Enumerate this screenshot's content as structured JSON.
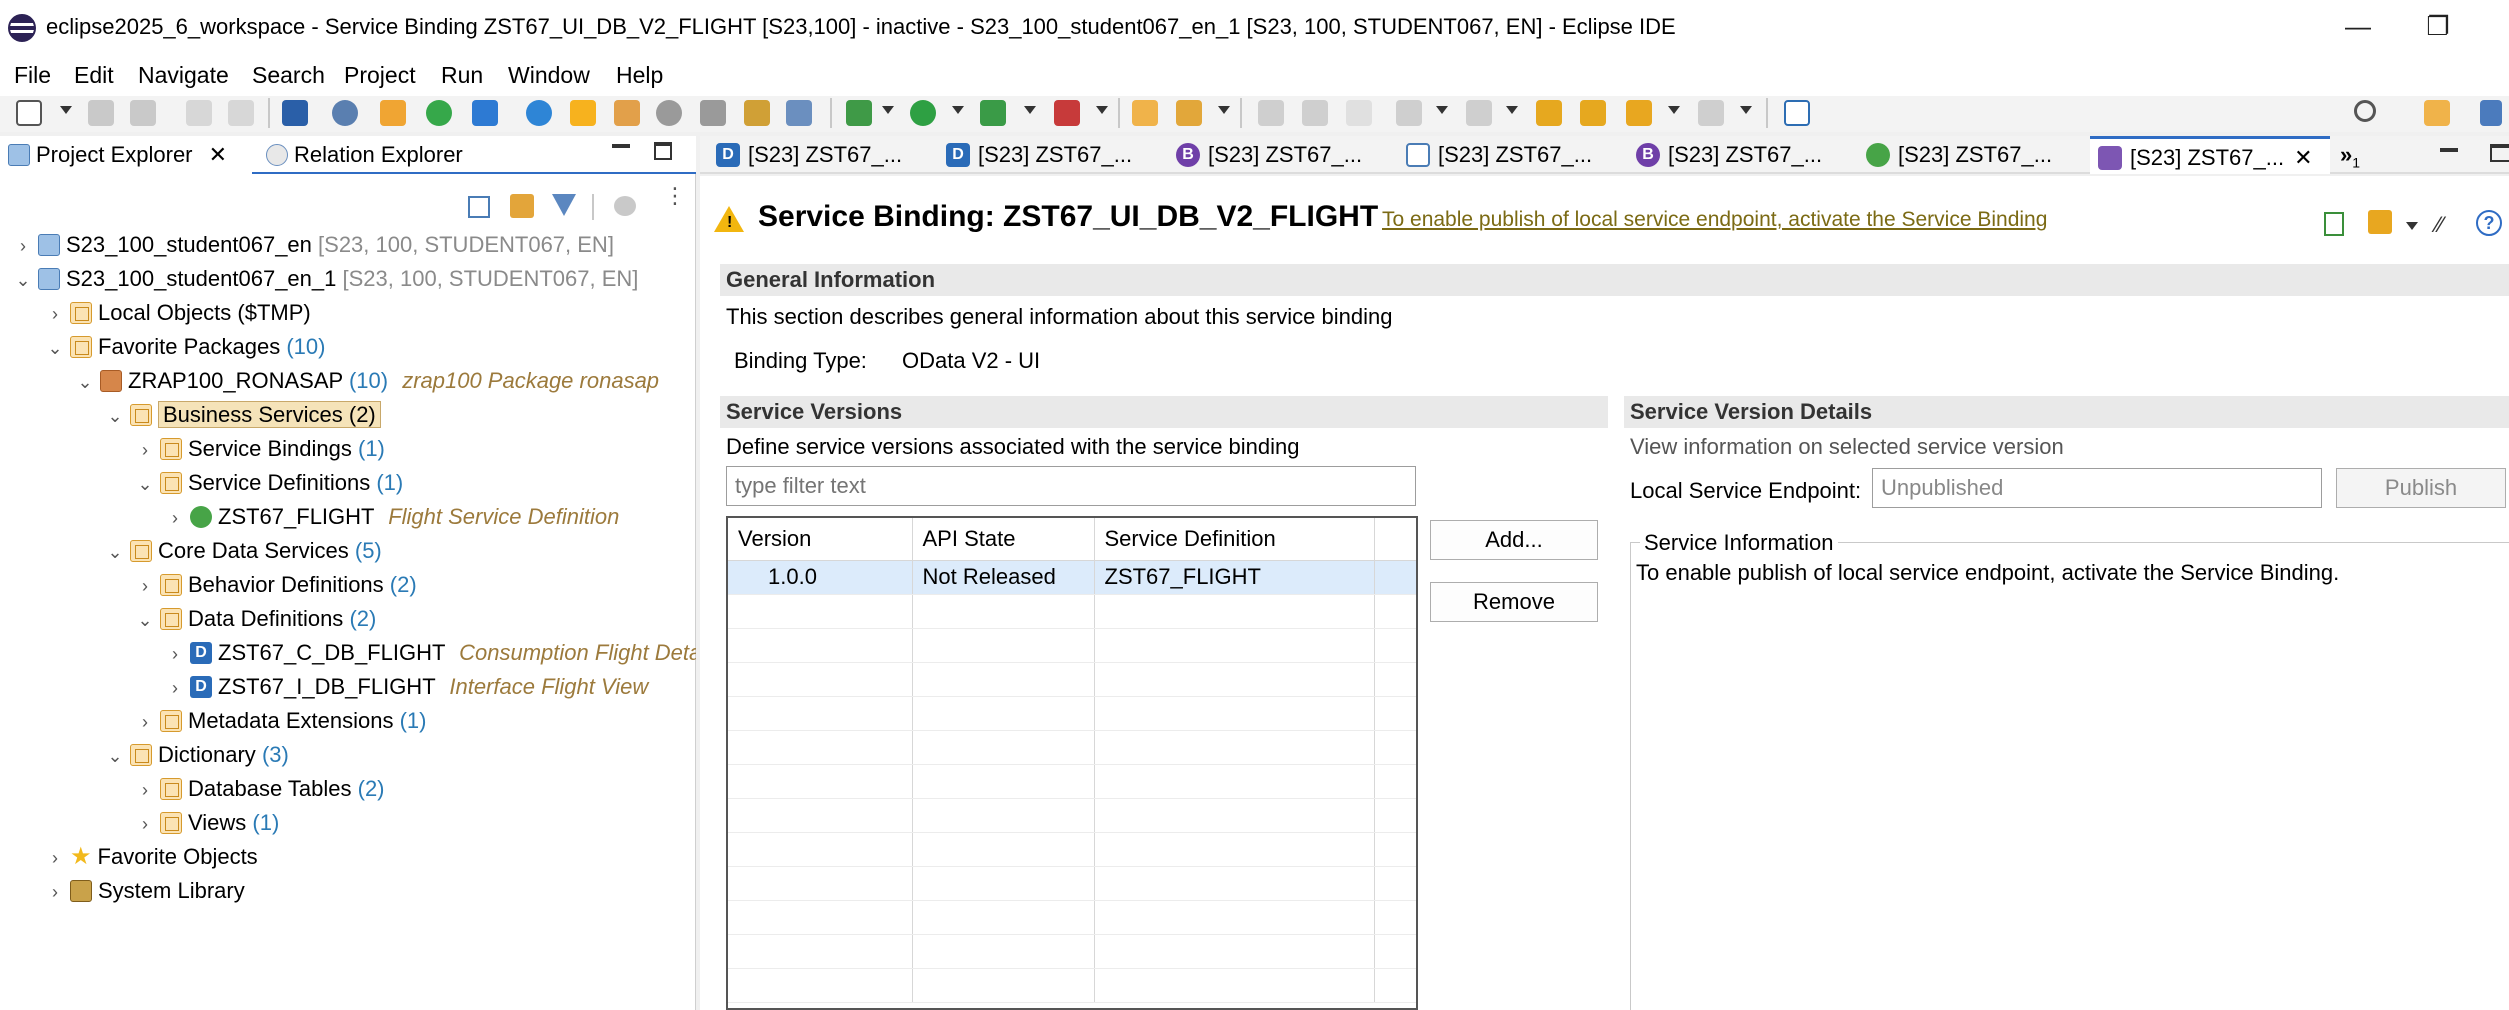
{
  "window": {
    "title": "eclipse2025_6_workspace - Service Binding ZST67_UI_DB_V2_FLIGHT [S23,100] - inactive - S23_100_student067_en_1 [S23, 100, STUDENT067, EN] - Eclipse IDE",
    "minimize": "—",
    "restore": "❐"
  },
  "menu": [
    "File",
    "Edit",
    "Navigate",
    "Search",
    "Project",
    "Run",
    "Window",
    "Help"
  ],
  "left_tabs": {
    "project_explorer": "Project Explorer",
    "relation_explorer": "Relation Explorer",
    "close": "✕"
  },
  "tree": [
    {
      "label": "S23_100_student067_en",
      "hint": "[S23, 100, STUDENT067, EN]"
    },
    {
      "label": "S23_100_student067_en_1",
      "hint": "[S23, 100, STUDENT067, EN]"
    },
    {
      "label": "Local Objects ($TMP)"
    },
    {
      "label": "Favorite Packages",
      "count": "(10)"
    },
    {
      "label": "ZRAP100_RONASAP",
      "count": "(10)",
      "desc": "zrap100 Package ronasap"
    },
    {
      "label": "Business Services",
      "count": "(2)"
    },
    {
      "label": "Service Bindings",
      "count": "(1)"
    },
    {
      "label": "Service Definitions",
      "count": "(1)"
    },
    {
      "label": "ZST67_FLIGHT",
      "desc": "Flight Service Definition"
    },
    {
      "label": "Core Data Services",
      "count": "(5)"
    },
    {
      "label": "Behavior Definitions",
      "count": "(2)"
    },
    {
      "label": "Data Definitions",
      "count": "(2)"
    },
    {
      "label": "ZST67_C_DB_FLIGHT",
      "desc": "Consumption Flight Deta"
    },
    {
      "label": "ZST67_I_DB_FLIGHT",
      "desc": "Interface Flight View"
    },
    {
      "label": "Metadata Extensions",
      "count": "(1)"
    },
    {
      "label": "Dictionary",
      "count": "(3)"
    },
    {
      "label": "Database Tables",
      "count": "(2)"
    },
    {
      "label": "Views",
      "count": "(1)"
    },
    {
      "label": "Favorite Objects"
    },
    {
      "label": "System Library"
    }
  ],
  "editor_tabs": [
    {
      "label": "[S23] ZST67_...",
      "icon": "D"
    },
    {
      "label": "[S23] ZST67_...",
      "icon": "D"
    },
    {
      "label": "[S23] ZST67_...",
      "icon": "B"
    },
    {
      "label": "[S23] ZST67_...",
      "icon": ""
    },
    {
      "label": "[S23] ZST67_...",
      "icon": "B"
    },
    {
      "label": "[S23] ZST67_...",
      "icon": ""
    },
    {
      "label": "[S23] ZST67_...",
      "icon": ""
    }
  ],
  "editor_tab_overflow": "»",
  "editor_tab_overflow_count": "1",
  "editor": {
    "title": "Service Binding: ZST67_UI_DB_V2_FLIGHT",
    "activate_link": "To enable publish of local service endpoint, activate the Service Binding",
    "general": {
      "title": "General Information",
      "description": "This section describes general information about this service binding",
      "binding_type_label": "Binding Type:",
      "binding_type_value": "OData V2 - UI"
    },
    "versions": {
      "title": "Service Versions",
      "description": "Define service versions associated with the service binding",
      "filter_placeholder": "type filter text",
      "columns": [
        "Version",
        "API State",
        "Service Definition"
      ],
      "rows": [
        {
          "version": "1.0.0",
          "api_state": "Not Released",
          "service_definition": "ZST67_FLIGHT"
        }
      ],
      "add_label": "Add...",
      "remove_label": "Remove"
    },
    "details": {
      "title": "Service Version Details",
      "description": "View information on selected service version",
      "endpoint_label": "Local Service Endpoint:",
      "endpoint_value": "Unpublished",
      "publish_label": "Publish",
      "info_title": "Service Information",
      "info_text": "To enable publish of local service endpoint, activate the Service Binding."
    }
  },
  "colors": {
    "accent": "#2f6cc4",
    "count": "#2a7ab5",
    "description": "#9c7a3c",
    "link": "#7b6a14",
    "selection": "#dcebfb"
  }
}
